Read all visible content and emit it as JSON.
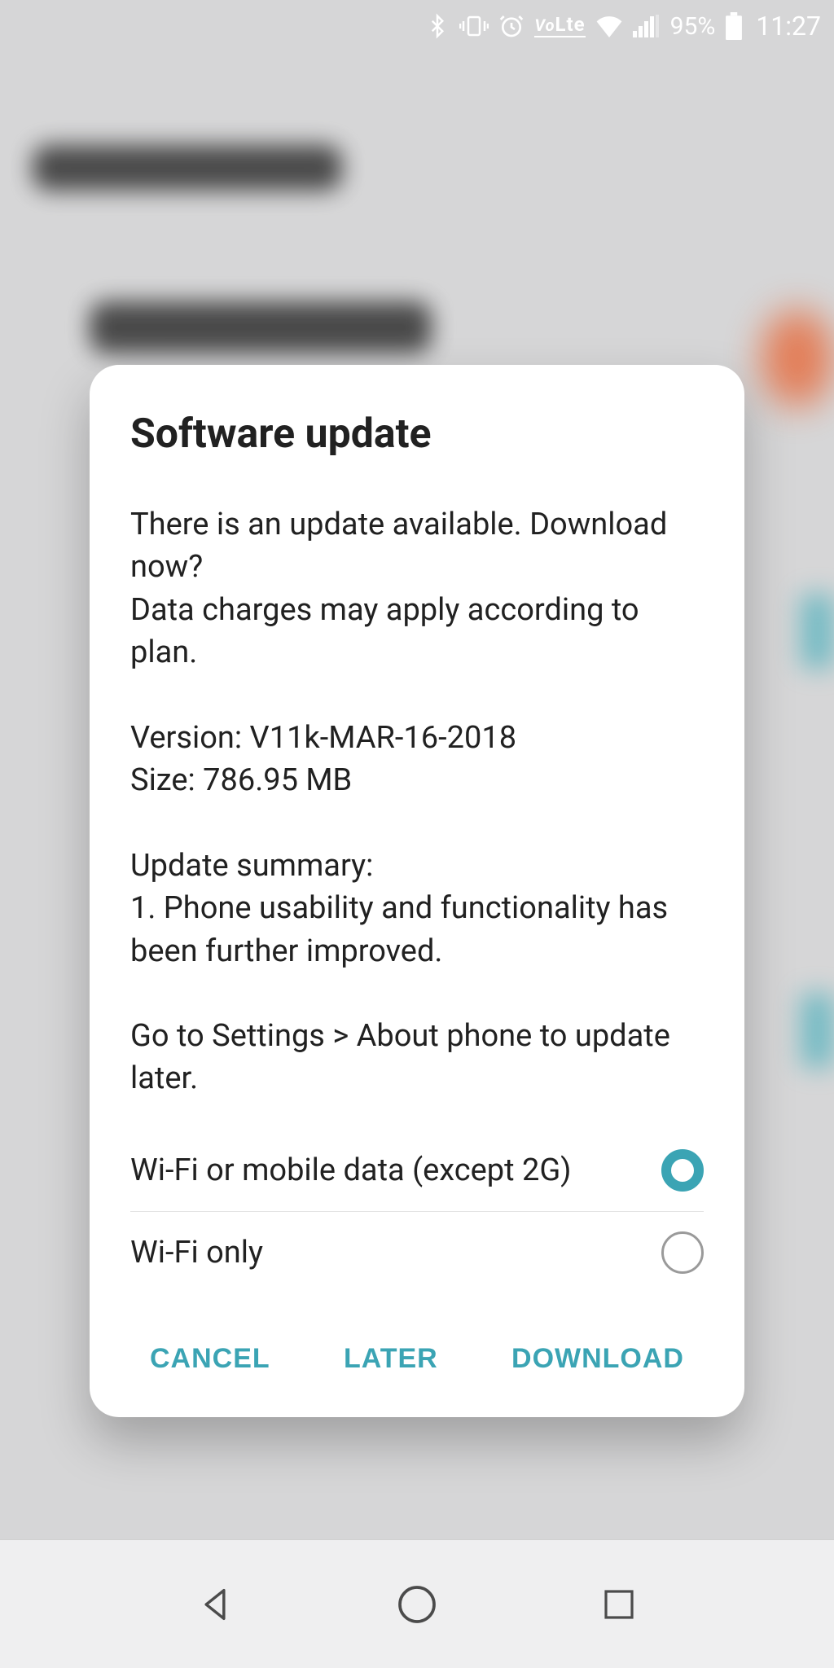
{
  "status": {
    "battery_pct": "95%",
    "clock": "11:27",
    "volte": "VoLte"
  },
  "dialog": {
    "title": "Software update",
    "p1": "There is an update available. Download now?\nData charges may apply according to plan.",
    "p2": "Version: V11k-MAR-16-2018\nSize: 786.95 MB",
    "p3": "Update summary:\n1. Phone usability and functionality has been further improved.",
    "p4": "Go to Settings > About phone to update later.",
    "radios": [
      {
        "label": "Wi-Fi or mobile data (except 2G)",
        "selected": true
      },
      {
        "label": "Wi-Fi only",
        "selected": false
      }
    ],
    "actions": {
      "cancel": "CANCEL",
      "later": "LATER",
      "download": "DOWNLOAD"
    }
  }
}
